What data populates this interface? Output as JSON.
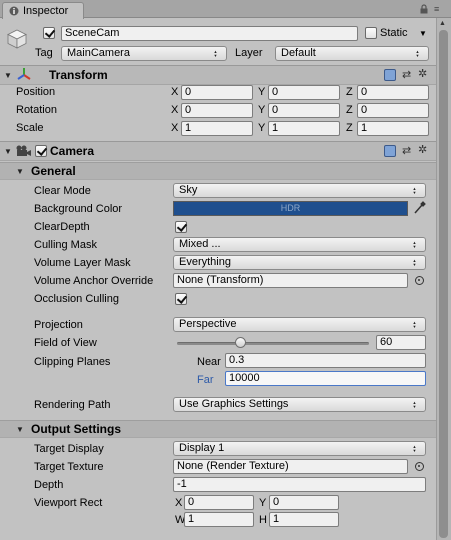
{
  "window": {
    "tab_title": "Inspector"
  },
  "header": {
    "object_name": "SceneCam",
    "active": true,
    "static_label": "Static",
    "static": false,
    "tag_label": "Tag",
    "tag_value": "MainCamera",
    "layer_label": "Layer",
    "layer_value": "Default"
  },
  "transform": {
    "title": "Transform",
    "rows": [
      {
        "label": "Position",
        "x": "0",
        "y": "0",
        "z": "0"
      },
      {
        "label": "Rotation",
        "x": "0",
        "y": "0",
        "z": "0"
      },
      {
        "label": "Scale",
        "x": "1",
        "y": "1",
        "z": "1"
      }
    ],
    "axes": {
      "x": "X",
      "y": "Y",
      "z": "Z"
    }
  },
  "camera": {
    "title": "Camera",
    "enabled": true,
    "general": {
      "title": "General",
      "clear_mode_label": "Clear Mode",
      "clear_mode_value": "Sky",
      "background_color_label": "Background Color",
      "background_color_hex": "#1f4f8e",
      "hdr_label": "HDR",
      "clear_depth_label": "ClearDepth",
      "clear_depth": true,
      "culling_mask_label": "Culling Mask",
      "culling_mask_value": "Mixed ...",
      "volume_layer_mask_label": "Volume Layer Mask",
      "volume_layer_mask_value": "Everything",
      "volume_anchor_label": "Volume Anchor Override",
      "volume_anchor_value": "None (Transform)",
      "occlusion_culling_label": "Occlusion Culling",
      "occlusion_culling": true,
      "projection_label": "Projection",
      "projection_value": "Perspective",
      "fov_label": "Field of View",
      "fov_value": "60",
      "fov_fraction": 0.33,
      "clipping_label": "Clipping Planes",
      "near_label": "Near",
      "near_value": "0.3",
      "far_label": "Far",
      "far_value": "10000",
      "rendering_path_label": "Rendering Path",
      "rendering_path_value": "Use Graphics Settings"
    },
    "output": {
      "title": "Output Settings",
      "target_display_label": "Target Display",
      "target_display_value": "Display 1",
      "target_texture_label": "Target Texture",
      "target_texture_value": "None (Render Texture)",
      "depth_label": "Depth",
      "depth_value": "-1",
      "viewport_label": "Viewport Rect",
      "viewport": {
        "x_label": "X",
        "x": "0",
        "y_label": "Y",
        "y": "0",
        "w_label": "W",
        "w": "1",
        "h_label": "H",
        "h": "1"
      }
    }
  }
}
